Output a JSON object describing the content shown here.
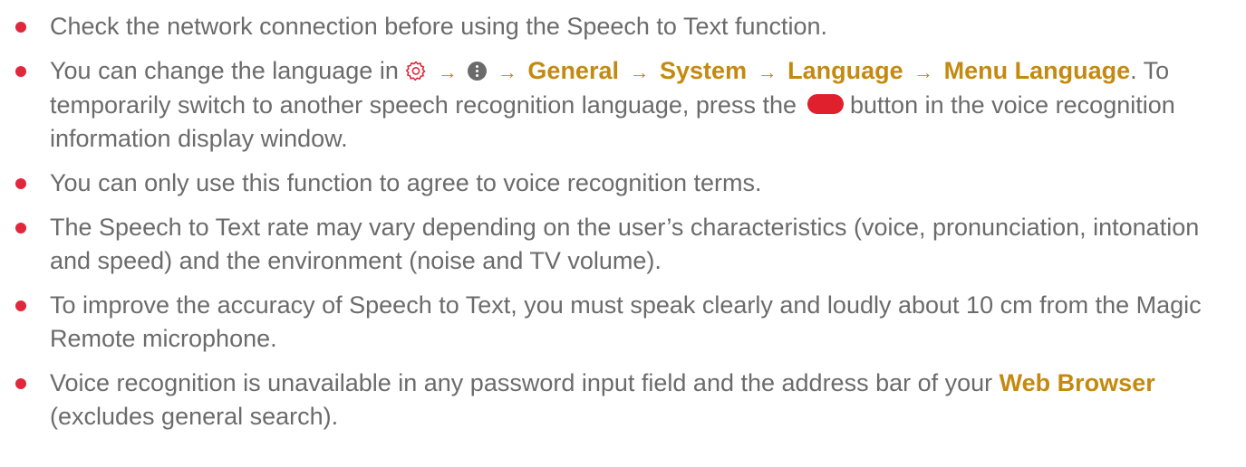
{
  "notes": [
    {
      "text": "Check the network connection before using the Speech to Text function."
    },
    {
      "pre": "You can change the language in",
      "path_icons": [
        "settings-gear-icon",
        "more-options-icon"
      ],
      "path": [
        "General",
        "System",
        "Language",
        "Menu Language"
      ],
      "arrow": "→",
      "mid": ". To temporarily switch to another speech recognition language, press the",
      "button_icon": "red-button-icon",
      "post": "button in the voice recognition information display window."
    },
    {
      "text": "You can only use this function to agree to voice recognition terms."
    },
    {
      "text": "The Speech to Text rate may vary depending on the user’s characteristics (voice, pronunciation, intonation and speed) and the environment (noise and TV volume)."
    },
    {
      "text": "To improve the accuracy of Speech to Text, you must speak clearly and loudly about 10 cm from the Magic Remote microphone."
    },
    {
      "pre": "Voice recognition is unavailable in any password input field and the address bar of your",
      "keyword": "Web Browser",
      "post": "(excludes general search)."
    }
  ],
  "colors": {
    "body_text": "#6b6b6b",
    "keyword": "#c48a10",
    "bullet": "#e0273c",
    "red_button": "#e0202c"
  }
}
